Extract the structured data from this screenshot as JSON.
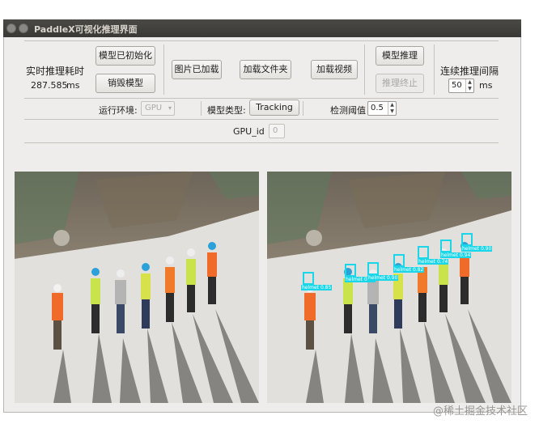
{
  "window": {
    "title": "PaddleX可视化推理界面"
  },
  "timing": {
    "label": "实时推理耗时",
    "value": "287.585",
    "unit": "ms"
  },
  "buttons": {
    "model_initialized": "模型已初始化",
    "destroy_model": "销毁模型",
    "image_loaded": "图片已加载",
    "load_folder": "加载文件夹",
    "load_video": "加载视频",
    "model_inference": "模型推理",
    "stop_inference": "推理终止"
  },
  "interval": {
    "label": "连续推理间隔",
    "value": "50",
    "unit": "ms"
  },
  "runtime": {
    "label": "运行环境:",
    "value": "GPU"
  },
  "model_type": {
    "label": "模型类型:",
    "value": "Tracking"
  },
  "threshold": {
    "label": "检测阈值",
    "value": "0.5"
  },
  "gpu": {
    "label": "GPU_id",
    "value": "0"
  },
  "detections": [
    {
      "label": "helmet 0.85"
    },
    {
      "label": "helmet 0.90"
    },
    {
      "label": "helmet 0.90"
    },
    {
      "label": "helmet 0.82"
    },
    {
      "label": "helmet 0.74"
    },
    {
      "label": "helmet 0.94"
    },
    {
      "label": "helmet 0.90"
    }
  ],
  "watermark": "@稀土掘金技术社区",
  "colors": {
    "bbox": "#1ad6e8",
    "titlebar": "#3f3e3b",
    "window_bg": "#efedec"
  }
}
